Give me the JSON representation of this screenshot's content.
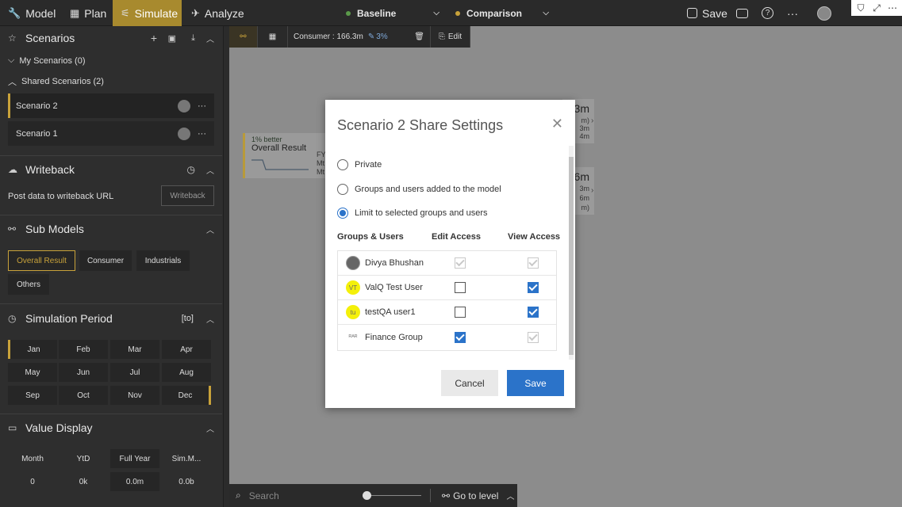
{
  "topbar": {
    "tabs": [
      {
        "label": "Model",
        "icon": "wrench-icon"
      },
      {
        "label": "Plan",
        "icon": "table-icon"
      },
      {
        "label": "Simulate",
        "icon": "simulate-icon"
      },
      {
        "label": "Analyze",
        "icon": "analyze-icon"
      }
    ],
    "baseline_label": "Baseline",
    "comparison_label": "Comparison",
    "baseline_color": "#5a9a4a",
    "comparison_color": "#c8a23a",
    "save_label": "Save"
  },
  "sidebar": {
    "scenarios": {
      "title": "Scenarios",
      "my_scenarios": "My Scenarios (0)",
      "shared_scenarios": "Shared Scenarios (2)",
      "items": [
        "Scenario 2",
        "Scenario 1"
      ]
    },
    "writeback": {
      "title": "Writeback",
      "post_label": "Post data to writeback URL",
      "button_label": "Writeback"
    },
    "submodels": {
      "title": "Sub Models",
      "chips": [
        "Overall Result",
        "Consumer",
        "Industrials",
        "Others"
      ]
    },
    "simulation_period": {
      "title": "Simulation Period",
      "badge": "[to]",
      "months": [
        "Jan",
        "Feb",
        "Mar",
        "Apr",
        "May",
        "Jun",
        "Jul",
        "Aug",
        "Sep",
        "Oct",
        "Nov",
        "Dec"
      ]
    },
    "value_display": {
      "title": "Value Display",
      "headers": [
        "Month",
        "YtD",
        "Full Year",
        "Sim.M..."
      ],
      "values": [
        "0",
        "0k",
        "0.0m",
        "0.0b"
      ]
    }
  },
  "canvas": {
    "toolbar": {
      "consumer_label": "Consumer : 166.3m",
      "pct_label": "3%",
      "edit_label": "Edit"
    },
    "node": {
      "better": "1% better",
      "title": "Overall Result",
      "fy": "FY",
      "mt1": "Mt",
      "mt2": "Mt"
    },
    "right_nodes": {
      "a1": "3m",
      "a2": "m)",
      "a3": "3m",
      "a4": "4m",
      "b1": "6m",
      "b2": "3m",
      "b3": "6m",
      "b4": "m)"
    },
    "bottom": {
      "search_placeholder": "Search",
      "goto_label": "Go to level"
    }
  },
  "modal": {
    "title": "Scenario 2 Share Settings",
    "options": [
      {
        "label": "Private",
        "selected": false
      },
      {
        "label": "Groups and users added to the model",
        "selected": false
      },
      {
        "label": "Limit to selected groups and users",
        "selected": true
      }
    ],
    "headers": {
      "groups": "Groups & Users",
      "edit": "Edit Access",
      "view": "View Access"
    },
    "rows": [
      {
        "name": "Divya Bhushan",
        "avatar": "",
        "edit": true,
        "edit_disabled": true,
        "view": true,
        "view_disabled": true
      },
      {
        "name": "ValQ Test User",
        "avatar": "VT",
        "edit": false,
        "edit_disabled": false,
        "view": true,
        "view_disabled": false
      },
      {
        "name": "testQA user1",
        "avatar": "tu",
        "edit": false,
        "edit_disabled": false,
        "view": true,
        "view_disabled": false
      },
      {
        "name": "Finance Group",
        "avatar": "ᴿᴬᴿ",
        "edit": true,
        "edit_disabled": false,
        "view": true,
        "view_disabled": true
      }
    ],
    "cancel_label": "Cancel",
    "save_label": "Save",
    "accent_color": "#2b73c9"
  }
}
